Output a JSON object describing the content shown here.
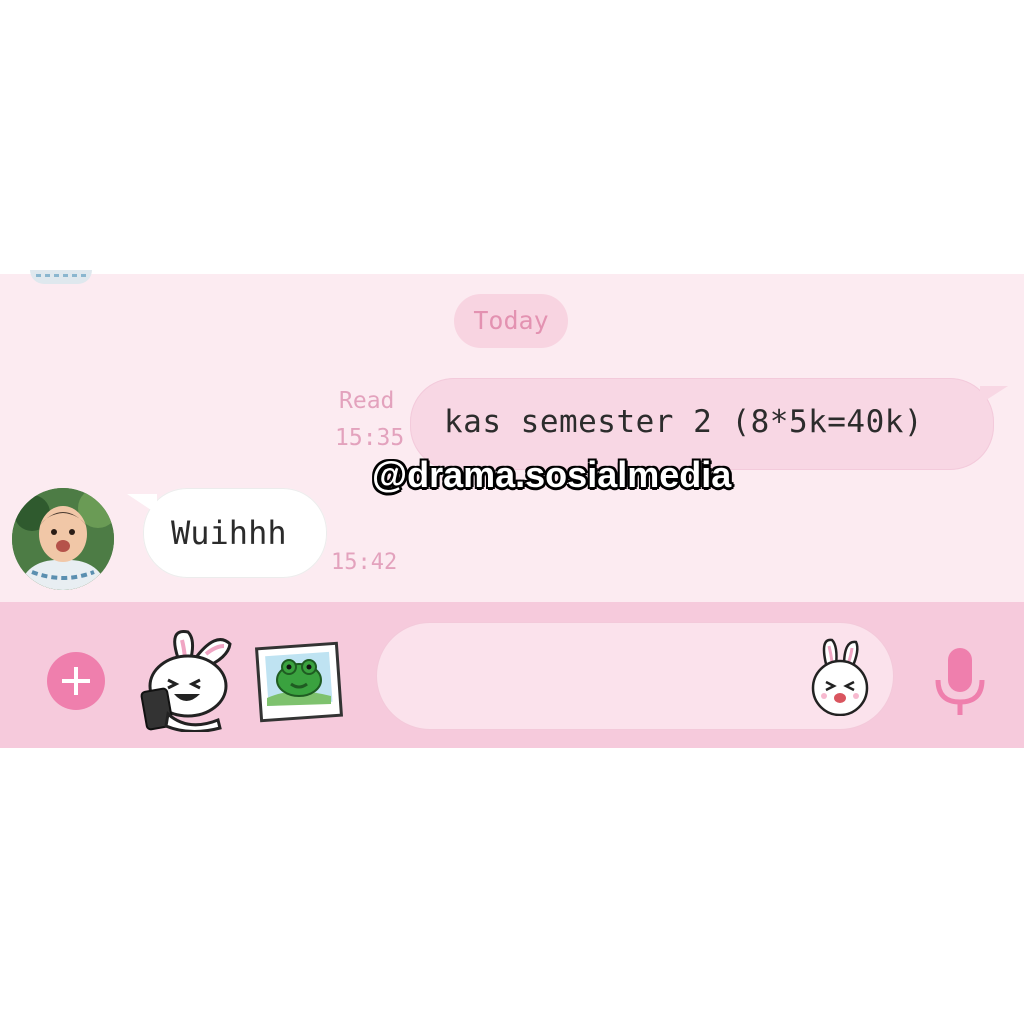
{
  "chat": {
    "date_label": "Today",
    "messages": [
      {
        "direction": "sent",
        "text": "kas semester 2 (8*5k=40k)",
        "status": "Read",
        "time": "15:35"
      },
      {
        "direction": "received",
        "text": "Wuihhh",
        "time": "15:42"
      }
    ]
  },
  "watermark": "@drama.sosialmedia",
  "input_bar": {
    "message_value": "",
    "icons": [
      "plus-icon",
      "rabbit-sticker-icon",
      "frog-photo-icon",
      "rabbit-emoji-icon",
      "microphone-icon"
    ]
  },
  "colors": {
    "chat_background": "#fcebf1",
    "bar_background": "#f6cadc",
    "accent": "#ef7fad",
    "sent_bubble": "#f8d7e4",
    "received_bubble": "#ffffff"
  }
}
